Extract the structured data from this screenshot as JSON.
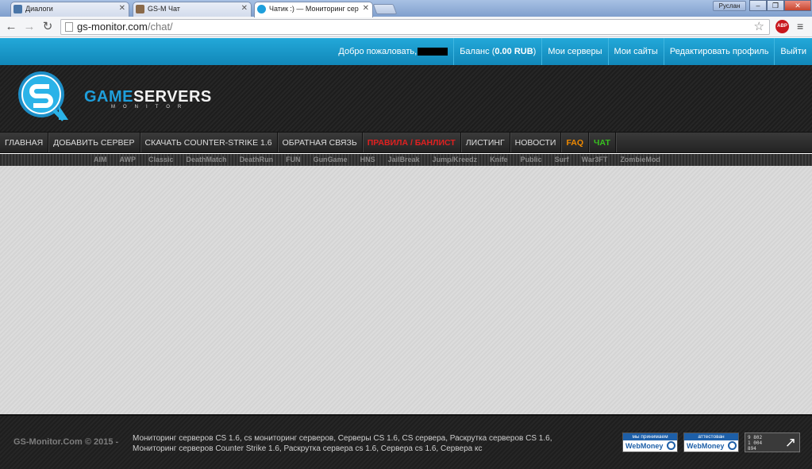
{
  "browser": {
    "tabs": [
      {
        "title": "Диалоги"
      },
      {
        "title": "GS-M Чат"
      },
      {
        "title": "Чатик :) — Мониторинг сер"
      }
    ],
    "user": "Руслан",
    "url_host": "gs-monitor.com",
    "url_path": "/chat/",
    "win_min": "–",
    "win_max": "❐",
    "win_close": "✕",
    "abp": "ABP"
  },
  "topbar": {
    "welcome": "Добро пожаловать,",
    "balance_label": "Баланс (",
    "balance_value": "0.00 RUB",
    "balance_end": ")",
    "links": [
      "Мои серверы",
      "Мои сайты",
      "Редактировать профиль",
      "Выйти"
    ]
  },
  "brand": {
    "part1": "GAME",
    "part2": "SERVERS",
    "sub": "MONITOR"
  },
  "mainnav": [
    {
      "label": "ГЛАВНАЯ",
      "color": "#dddddd"
    },
    {
      "label": "ДОБАВИТЬ СЕРВЕР",
      "color": "#dddddd"
    },
    {
      "label": "СКАЧАТЬ COUNTER-STRIKE 1.6",
      "color": "#dddddd"
    },
    {
      "label": "ОБРАТНАЯ СВЯЗЬ",
      "color": "#dddddd"
    },
    {
      "label": "ПРАВИЛА / БАНЛИСТ",
      "color": "#e02020"
    },
    {
      "label": "ЛИСТИНГ",
      "color": "#dddddd"
    },
    {
      "label": "НОВОСТИ",
      "color": "#dddddd"
    },
    {
      "label": "FAQ",
      "color": "#f08a00"
    },
    {
      "label": "ЧАТ",
      "color": "#38c21f"
    }
  ],
  "subnav": [
    "AIM",
    "AWP",
    "Classic",
    "DeathMatch",
    "DeathRun",
    "FUN",
    "GunGame",
    "HNS",
    "JailBreak",
    "Jump/Kreedz",
    "Knife",
    "Public",
    "Surf",
    "War3FT",
    "ZombieMod"
  ],
  "footer": {
    "copyright": "GS-Monitor.Com © 2015 -",
    "line1": "Мониторинг серверов CS 1.6, cs мониторинг серверов, Серверы CS 1.6, CS сервера, Раскрутка серверов CS 1.6,",
    "line2": "Мониторинг серверов Counter Strike 1.6, Раскрутка сервера cs 1.6, Сервера cs 1.6, Сервера кс",
    "wm1_top": "мы принимаем",
    "wm1_bottom": "WebMoney",
    "wm2_top": "аттестован",
    "wm2_bottom": "WebMoney",
    "counter": [
      "9 802",
      "1 004",
      "894"
    ]
  }
}
